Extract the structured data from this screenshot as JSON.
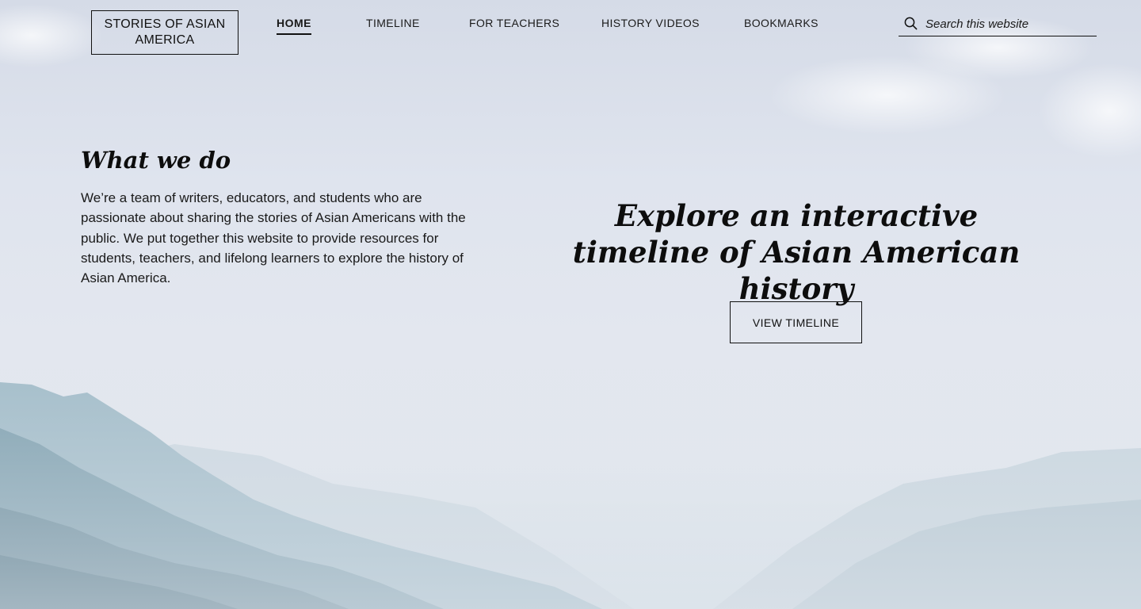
{
  "header": {
    "logo_text": "STORIES OF ASIAN AMERICA",
    "nav": [
      {
        "label": "HOME",
        "active": true
      },
      {
        "label": "TIMELINE",
        "active": false
      },
      {
        "label": "FOR TEACHERS",
        "active": false
      },
      {
        "label": "HISTORY VIDEOS",
        "active": false
      },
      {
        "label": "BOOKMARKS",
        "active": false
      }
    ],
    "search": {
      "placeholder": "Search this website",
      "value": "",
      "icon": "search-icon"
    }
  },
  "about": {
    "heading": "What we do",
    "body": "We’re a team of writers, educators, and students who are passionate about sharing the stories of Asian Americans with the public. We put together this website to provide resources for students, teachers, and lifelong learners to explore the history of Asian America."
  },
  "hero": {
    "headline": "Explore an interactive timeline of Asian American history",
    "cta_label": "VIEW TIMELINE"
  },
  "colors": {
    "text": "#111111",
    "sky": "#dfe4ee",
    "mountain_far": "#c6d4de",
    "mountain_mid": "#9fb8c5",
    "mountain_near": "#6f8f9e"
  }
}
